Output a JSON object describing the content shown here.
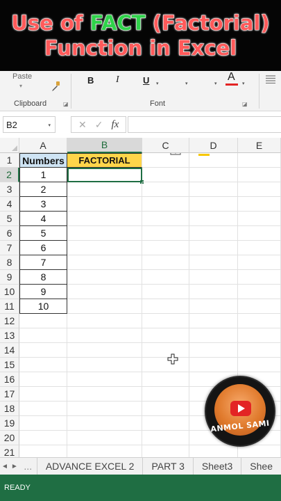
{
  "banner": {
    "line1_pre": "Use of ",
    "line1_hl": "FACT",
    "line1_post": " (Factorial)",
    "line2": "Function in Excel"
  },
  "ribbon": {
    "paste_label": "Paste",
    "clipboard_label": "Clipboard",
    "font_label": "Font",
    "bold_label": "B",
    "italic_label": "I",
    "underline_label": "U",
    "font_color_label": "A",
    "fill_color": "#f7c700",
    "font_color": "#e32424"
  },
  "formula_bar": {
    "name_box": "B2",
    "fx_label": "fx",
    "cancel_glyph": "✕",
    "enter_glyph": "✓"
  },
  "grid": {
    "columns": [
      "A",
      "B",
      "C",
      "D",
      "E"
    ],
    "active_column": "B",
    "active_row": "2",
    "rows": [
      {
        "n": "1",
        "a": "Numbers",
        "b": "FACTORIAL"
      },
      {
        "n": "2",
        "a": "1",
        "b": ""
      },
      {
        "n": "3",
        "a": "2",
        "b": ""
      },
      {
        "n": "4",
        "a": "3",
        "b": ""
      },
      {
        "n": "5",
        "a": "4",
        "b": ""
      },
      {
        "n": "6",
        "a": "5",
        "b": ""
      },
      {
        "n": "7",
        "a": "6",
        "b": ""
      },
      {
        "n": "8",
        "a": "7",
        "b": ""
      },
      {
        "n": "9",
        "a": "8",
        "b": ""
      },
      {
        "n": "10",
        "a": "9",
        "b": ""
      },
      {
        "n": "11",
        "a": "10",
        "b": ""
      },
      {
        "n": "12",
        "a": "",
        "b": ""
      },
      {
        "n": "13",
        "a": "",
        "b": ""
      },
      {
        "n": "14",
        "a": "",
        "b": ""
      },
      {
        "n": "15",
        "a": "",
        "b": ""
      },
      {
        "n": "16",
        "a": "",
        "b": ""
      },
      {
        "n": "17",
        "a": "",
        "b": ""
      },
      {
        "n": "18",
        "a": "",
        "b": ""
      },
      {
        "n": "19",
        "a": "",
        "b": ""
      },
      {
        "n": "20",
        "a": "",
        "b": ""
      },
      {
        "n": "21",
        "a": "",
        "b": ""
      }
    ]
  },
  "logo": {
    "text": "ANMOL SAMI"
  },
  "tabs": {
    "prev": "◄",
    "next": "►",
    "ellipsis": "...",
    "items": [
      "ADVANCE EXCEL 2",
      "PART 3",
      "Sheet3",
      "Shee"
    ]
  },
  "status": {
    "text": "READY"
  },
  "colors": {
    "accent": "#1f6e43",
    "header_a_fill": "#cfe4f4",
    "header_b_fill": "#ffd54a"
  }
}
